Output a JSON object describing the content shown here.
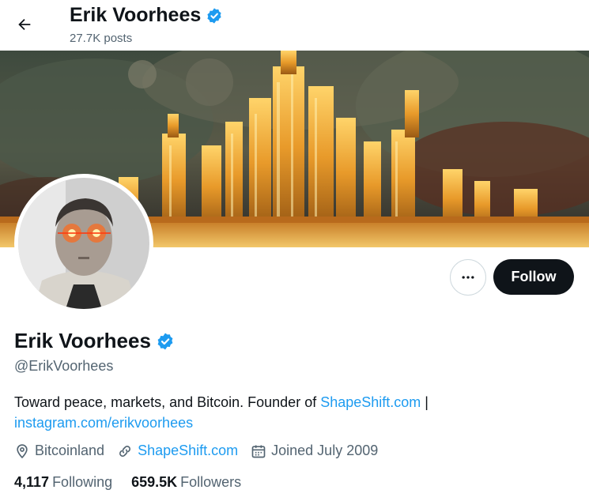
{
  "header": {
    "name": "Erik Voorhees",
    "posts": "27.7K posts",
    "back_icon": "arrow-left-icon"
  },
  "profile": {
    "name": "Erik Voorhees",
    "handle": "@ErikVoorhees",
    "verified_icon": "verified-badge-icon",
    "verified_color": "#1d9bf0",
    "bio_text": "Toward peace, markets, and Bitcoin. Founder of ",
    "bio_link1": "ShapeShift.com",
    "bio_sep": " |",
    "bio_link2": "instagram.com/erikvoorhees",
    "location": "Bitcoinland",
    "website": "ShapeShift.com",
    "joined": "Joined July 2009"
  },
  "stats": {
    "following_count": "4,117",
    "following_label": "Following",
    "followers_count": "659.5K",
    "followers_label": "Followers"
  },
  "actions": {
    "more_icon": "more-dots-icon",
    "follow_label": "Follow"
  },
  "colors": {
    "link": "#1d9bf0",
    "secondary_text": "#536471",
    "follow_bg": "#0f1419"
  }
}
